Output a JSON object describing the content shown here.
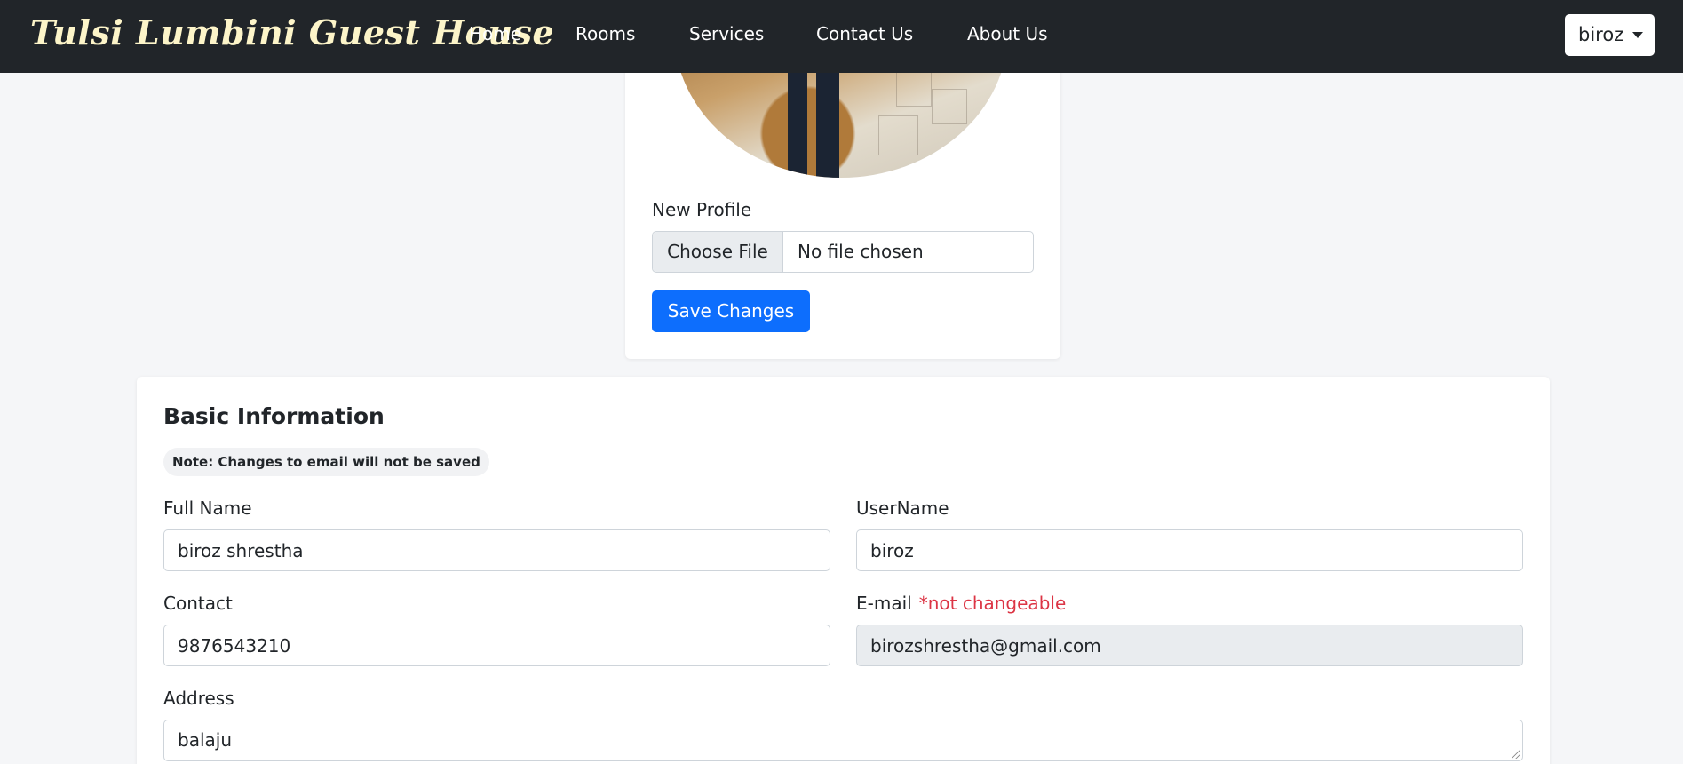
{
  "navbar": {
    "brand": "Tulsi Lumbini Guest House",
    "links": [
      "Home",
      "Rooms",
      "Services",
      "Contact Us",
      "About Us"
    ],
    "user": "biroz"
  },
  "profile": {
    "new_profile_label": "New Profile",
    "file_button": "Choose File",
    "file_status": "No file chosen",
    "save_button": "Save Changes"
  },
  "basic_info": {
    "title": "Basic Information",
    "note": "Note: Changes to email will not be saved",
    "full_name_label": "Full Name",
    "full_name_value": "biroz shrestha",
    "username_label": "UserName",
    "username_value": "biroz",
    "contact_label": "Contact",
    "contact_value": "9876543210",
    "email_label": "E-mail",
    "email_note": "*not changeable",
    "email_value": "birozshrestha@gmail.com",
    "address_label": "Address",
    "address_value": "balaju"
  },
  "colors": {
    "navbar_bg": "#212529",
    "brand": "#fdf5c9",
    "primary": "#0d6efd",
    "danger": "#dc3545",
    "page_bg": "#f5f6f8"
  }
}
